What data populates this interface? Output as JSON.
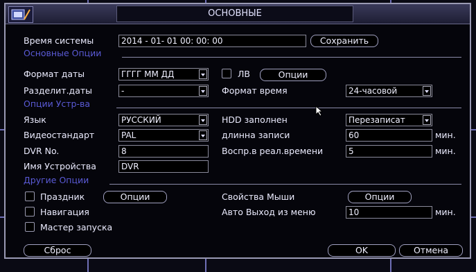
{
  "window": {
    "title": "ОСНОВНЫЕ"
  },
  "system_time": {
    "label": "Время системы",
    "value": "2014 - 01- 01  00: 00: 00",
    "save_button": "Сохранить"
  },
  "basic_options": {
    "section_title": "Основные Опции",
    "date_format_label": "Формат даты",
    "date_format_value": "ГГГГ ММ ДД",
    "dst_label": "ЛВ",
    "dst_checked": false,
    "options_button": "Опции",
    "date_separator_label": "Разделит.даты",
    "date_separator_value": "-",
    "time_format_label": "Формат время",
    "time_format_value": "24-часовой"
  },
  "device_options": {
    "section_title": "Опции Устр-ва",
    "language_label": "Язык",
    "language_value": "РУССКИЙ",
    "hdd_full_label": "HDD заполнен",
    "hdd_full_value": "Перезаписат",
    "video_standard_label": "Видеостандарт",
    "video_standard_value": "PAL",
    "record_length_label": "длинна записи",
    "record_length_value": "60",
    "record_length_unit": "мин.",
    "dvr_no_label": "DVR No.",
    "dvr_no_value": "8",
    "realtime_playback_label": "Воспр.в реал.времени",
    "realtime_playback_value": "5",
    "realtime_playback_unit": "мин.",
    "device_name_label": "Имя Устройства",
    "device_name_value": "DVR"
  },
  "other_options": {
    "section_title": "Другие Опции",
    "holiday_label": "Праздник",
    "holiday_checked": false,
    "holiday_options_button": "Опции",
    "mouse_props_label": "Свойства Мыши",
    "mouse_options_button": "Опции",
    "navigation_label": "Навигация",
    "navigation_checked": false,
    "auto_exit_label": "Авто Выход из меню",
    "auto_exit_value": "10",
    "auto_exit_unit": "мин.",
    "wizard_label": "Мастер запуска",
    "wizard_checked": false
  },
  "footer": {
    "reset_button": "Сброс",
    "ok_button": "OK",
    "cancel_button": "Отмена"
  },
  "colors": {
    "section": "#5a5ad6",
    "background": "#05050b",
    "border": "#9a9ab4"
  },
  "icons": {
    "logo": "dvr-logo-icon",
    "cursor": "mouse-pointer-icon",
    "dropdown": "chevron-down-icon"
  }
}
